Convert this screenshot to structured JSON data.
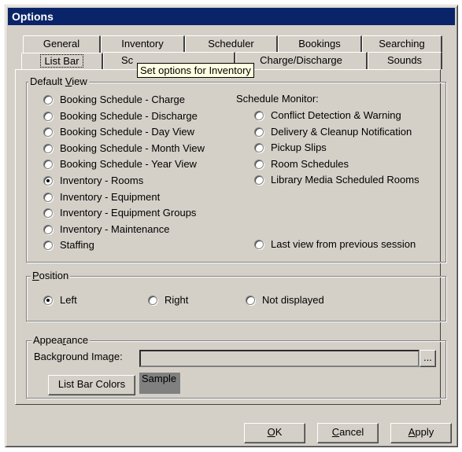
{
  "window": {
    "title": "Options"
  },
  "tabs_row1": [
    "General",
    "Inventory",
    "Scheduler",
    "Bookings",
    "Searching"
  ],
  "tabs_row2": [
    "List Bar",
    "Sc",
    "Charge/Discharge",
    "Sounds"
  ],
  "active_tab": "List Bar",
  "tooltip": "Set options for Inventory",
  "default_view": {
    "legend_pre": "Default ",
    "legend_key": "V",
    "legend_post": "iew",
    "options": [
      {
        "label": "Booking Schedule - Charge",
        "checked": false
      },
      {
        "label": "Booking Schedule - Discharge",
        "checked": false
      },
      {
        "label": "Booking Schedule - Day View",
        "checked": false
      },
      {
        "label": "Booking Schedule - Month View",
        "checked": false
      },
      {
        "label": "Booking Schedule - Year View",
        "checked": false
      },
      {
        "label": "Inventory - Rooms",
        "checked": true
      },
      {
        "label": "Inventory - Equipment",
        "checked": false
      },
      {
        "label": "Inventory - Equipment Groups",
        "checked": false
      },
      {
        "label": "Inventory - Maintenance",
        "checked": false
      },
      {
        "label": "Staffing",
        "checked": false
      }
    ],
    "monitor_heading": "Schedule Monitor:",
    "monitor_options": [
      {
        "label": "Conflict Detection & Warning",
        "checked": false
      },
      {
        "label": "Delivery & Cleanup Notification",
        "checked": false
      },
      {
        "label": "Pickup Slips",
        "checked": false
      },
      {
        "label": "Room Schedules",
        "checked": false
      },
      {
        "label": "Library Media Scheduled Rooms",
        "checked": false
      }
    ],
    "last_view_label": "Last view from previous session"
  },
  "position": {
    "legend_key": "P",
    "legend_post": "osition",
    "options": [
      {
        "label": "Left",
        "checked": true
      },
      {
        "label": "Right",
        "checked": false
      },
      {
        "label": "Not displayed",
        "checked": false
      }
    ]
  },
  "appearance": {
    "legend_pre": "Appea",
    "legend_key": "r",
    "legend_post": "ance",
    "background_label": "Background Image:",
    "background_value": "",
    "browse_label": "...",
    "colors_button": "List Bar Colors",
    "sample_label": "Sample",
    "sample_color": "#808080"
  },
  "buttons": {
    "ok_key": "O",
    "ok_rest": "K",
    "cancel_key": "C",
    "cancel_rest": "ancel",
    "apply_key": "A",
    "apply_rest": "pply"
  },
  "colors": {
    "titlebar": "#0a246a",
    "face": "#d4d0c8",
    "tooltip": "#ffffe1"
  }
}
